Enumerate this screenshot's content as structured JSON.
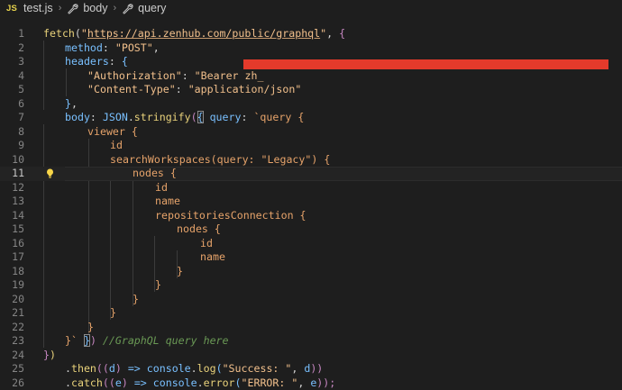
{
  "breadcrumb": {
    "file_icon": "JS",
    "file": "test.js",
    "items": [
      "body",
      "query"
    ]
  },
  "lines": [
    {
      "n": "1",
      "text": "fetch(\"https://api.zenhub.com/public/graphql\", {"
    },
    {
      "n": "2",
      "text": "  method: \"POST\","
    },
    {
      "n": "3",
      "text": "  headers: {"
    },
    {
      "n": "4",
      "text": "    \"Authorization\": \"Bearer zh_"
    },
    {
      "n": "5",
      "text": "    \"Content-Type\": \"application/json\""
    },
    {
      "n": "6",
      "text": "  },"
    },
    {
      "n": "7",
      "text": "  body: JSON.stringify({ query: `query {"
    },
    {
      "n": "8",
      "text": "    viewer {"
    },
    {
      "n": "9",
      "text": "      id"
    },
    {
      "n": "10",
      "text": "      searchWorkspaces(query: \"Legacy\") {"
    },
    {
      "n": "11",
      "text": "        nodes {"
    },
    {
      "n": "12",
      "text": "          id"
    },
    {
      "n": "13",
      "text": "          name"
    },
    {
      "n": "14",
      "text": "          repositoriesConnection {"
    },
    {
      "n": "15",
      "text": "            nodes {"
    },
    {
      "n": "16",
      "text": "              id"
    },
    {
      "n": "17",
      "text": "              name"
    },
    {
      "n": "18",
      "text": "            }"
    },
    {
      "n": "19",
      "text": "          }"
    },
    {
      "n": "20",
      "text": "        }"
    },
    {
      "n": "21",
      "text": "      }"
    },
    {
      "n": "22",
      "text": "    }"
    },
    {
      "n": "23",
      "text": "  }` }) //GraphQL query here"
    },
    {
      "n": "24",
      "text": "})"
    },
    {
      "n": "25",
      "text": "  .then((d) => console.log(\"Success: \", d))"
    },
    {
      "n": "26",
      "text": "  .catch((e) => console.error(\"ERROR: \", e));"
    }
  ],
  "tokens": {
    "l1": [
      "fetch",
      "(",
      "\"",
      "https://api.zenhub.com/public/graphql",
      "\"",
      ", ",
      "{"
    ],
    "l2": [
      "method",
      ": ",
      "\"POST\"",
      ","
    ],
    "l3": [
      "headers",
      ": ",
      "{"
    ],
    "l4": [
      "\"Authorization\"",
      ": ",
      "\"Bearer zh_"
    ],
    "l5": [
      "\"Content-Type\"",
      ": ",
      "\"application/json\""
    ],
    "l6": [
      "}",
      ","
    ],
    "l7": [
      "body",
      ": ",
      "JSON",
      ".",
      "stringify",
      "(",
      "{",
      " ",
      "query",
      ": ",
      "`query {"
    ],
    "l8": [
      "viewer {"
    ],
    "l9": [
      "id"
    ],
    "l10": [
      "searchWorkspaces(query: \"Legacy\") {"
    ],
    "l11": [
      "nodes {"
    ],
    "l12": [
      "id"
    ],
    "l13": [
      "name"
    ],
    "l14": [
      "repositoriesConnection {"
    ],
    "l15": [
      "nodes {"
    ],
    "l16": [
      "id"
    ],
    "l17": [
      "name"
    ],
    "l18": [
      "}"
    ],
    "l19": [
      "}"
    ],
    "l20": [
      "}"
    ],
    "l21": [
      "}"
    ],
    "l22": [
      "}"
    ],
    "l23": [
      "}`",
      " ",
      "}",
      ")",
      " ",
      "//GraphQL query here"
    ],
    "l24": [
      "}",
      ")"
    ],
    "l25": [
      ".",
      "then",
      "((",
      "d",
      ") ",
      "=>",
      " ",
      "console",
      ".",
      "log",
      "(",
      "\"Success: \"",
      ", ",
      "d",
      "))"
    ],
    "l26": [
      ".",
      "catch",
      "((",
      "e",
      ") ",
      "=>",
      " ",
      "console",
      ".",
      "error",
      "(",
      "\"ERROR: \"",
      ", ",
      "e",
      "));"
    ]
  },
  "active_line": "11",
  "colors": {
    "background": "#1e1e1e",
    "keyword_blue": "#79c0ff",
    "string": "#f2c08c",
    "function": "#e9d27b",
    "comment": "#6a9955",
    "redaction": "#e43a2b"
  }
}
